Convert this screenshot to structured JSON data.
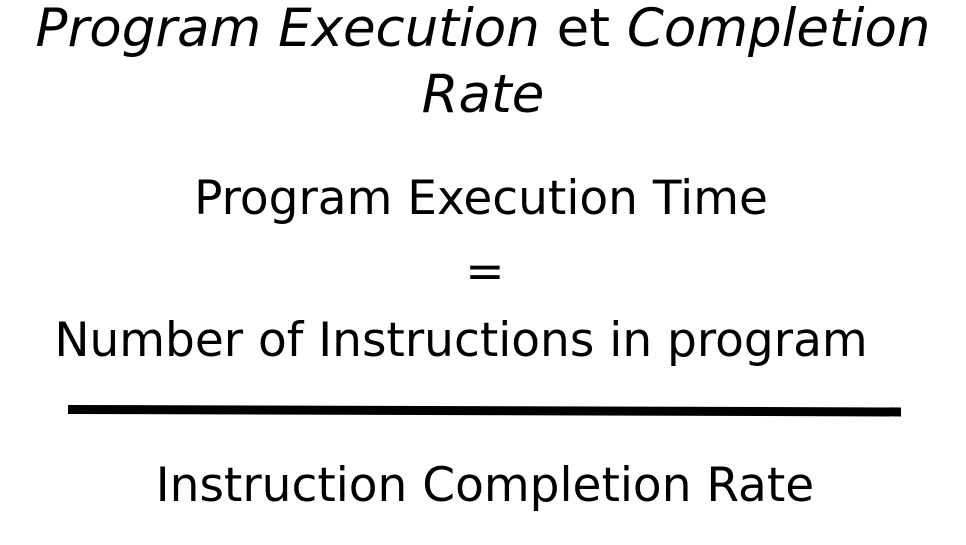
{
  "title": {
    "part1": "Program Execution",
    "connector": " et ",
    "part2": "Completion",
    "part3": "Rate"
  },
  "formula": {
    "lhs": "Program Execution Time",
    "equals": "=",
    "numerator": "Number of Instructions in program",
    "denominator": "Instruction Completion Rate"
  },
  "colors": {
    "text": "#000000",
    "background": "#ffffff"
  }
}
